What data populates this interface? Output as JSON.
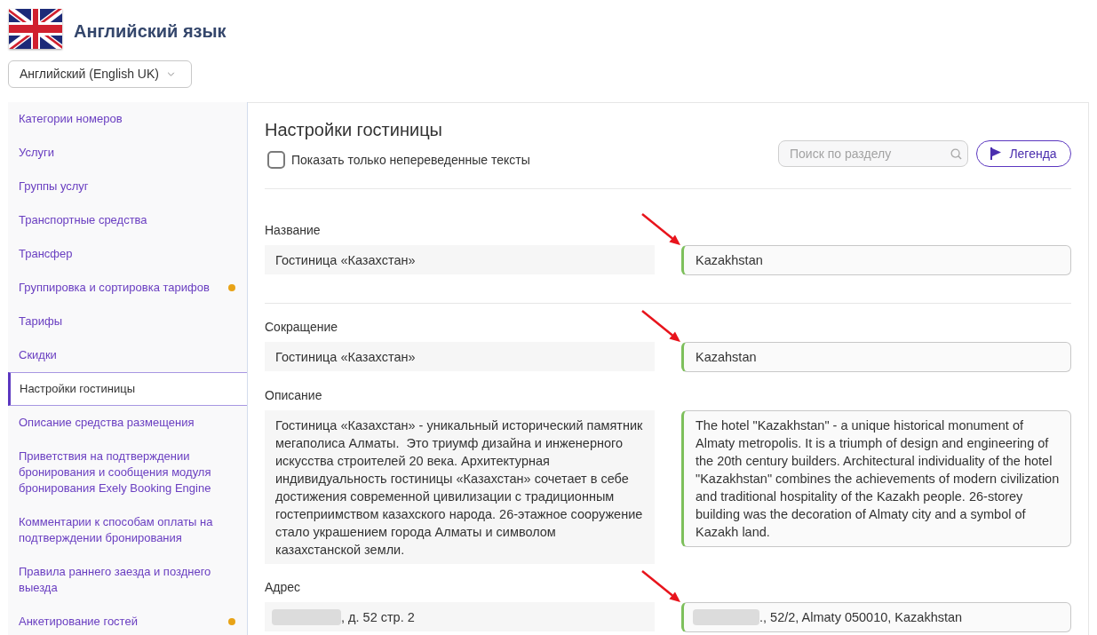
{
  "header": {
    "title": "Английский язык",
    "language_select": {
      "value": "Английский (English UK)"
    }
  },
  "sidebar": {
    "items": [
      {
        "label": "Категории номеров",
        "selected": false,
        "dot": false
      },
      {
        "label": "Услуги",
        "selected": false,
        "dot": false
      },
      {
        "label": "Группы услуг",
        "selected": false,
        "dot": false
      },
      {
        "label": "Транспортные средства",
        "selected": false,
        "dot": false
      },
      {
        "label": "Трансфер",
        "selected": false,
        "dot": false
      },
      {
        "label": "Группировка и сортировка тарифов",
        "selected": false,
        "dot": true
      },
      {
        "label": "Тарифы",
        "selected": false,
        "dot": false
      },
      {
        "label": "Скидки",
        "selected": false,
        "dot": false
      },
      {
        "label": "Настройки гостиницы",
        "selected": true,
        "dot": false
      },
      {
        "label": "Описание средства размещения",
        "selected": false,
        "dot": false
      },
      {
        "label": "Приветствия на подтверждении бронирования и сообщения модуля бронирования Exely Booking Engine",
        "selected": false,
        "dot": false
      },
      {
        "label": "Комментарии к способам оплаты на подтверждении бронирования",
        "selected": false,
        "dot": false
      },
      {
        "label": "Правила раннего заезда и позднего выезда",
        "selected": false,
        "dot": false
      },
      {
        "label": "Анкетирование гостей",
        "selected": false,
        "dot": true
      }
    ]
  },
  "panel": {
    "title": "Настройки гостиницы",
    "untranslated_filter": {
      "label": "Показать только непереведенные тексты",
      "checked": false
    },
    "search": {
      "placeholder": "Поиск по разделу"
    },
    "legend_button": {
      "label": "Легенда"
    }
  },
  "fields": [
    {
      "label": "Название",
      "source": {
        "text": "Гостиница «Казахстан»",
        "redacted": false
      },
      "translation": {
        "text": "Kazakhstan",
        "redacted": false,
        "translated": true
      },
      "arrow": true,
      "divider": true
    },
    {
      "label": "Сокращение",
      "source": {
        "text": "Гостиница «Казахстан»",
        "redacted": false
      },
      "translation": {
        "text": "Kazahstan",
        "redacted": false,
        "translated": true
      },
      "arrow": true,
      "divider": false
    },
    {
      "label": "Описание",
      "source": {
        "text": "Гостиница «Казахстан» - уникальный исторический памятник мегаполиса Алматы.  Это триумф дизайна и инженерного искусства строителей 20 века. Архитектурная индивидуальность гостиницы «Казахстан» сочетает в себе достижения современной цивилизации с традиционным гостеприимством казахского народа. 26-этажное сооружение стало украшением города Алматы и символом казахстанской земли.",
        "redacted": false
      },
      "translation": {
        "text": "The hotel \"Kazakhstan\" - a unique historical monument of Almaty metropolis. It is a triumph of design and engineering of the 20th century builders. Architectural individuality of the hotel \"Kazakhstan\" combines the achievements of modern civilization and traditional hospitality of the Kazakh people. 26-storey building was the decoration of Almaty city and a symbol of Kazakh land.",
        "redacted": false,
        "translated": true
      },
      "arrow": false,
      "divider": false
    },
    {
      "label": "Адрес",
      "source": {
        "text": ", д. 52 стр. 2",
        "redacted": true
      },
      "translation": {
        "text": "., 52/2, Almaty 050010, Kazakhstan",
        "redacted": true,
        "translated": true
      },
      "arrow": true,
      "divider": false
    }
  ]
}
